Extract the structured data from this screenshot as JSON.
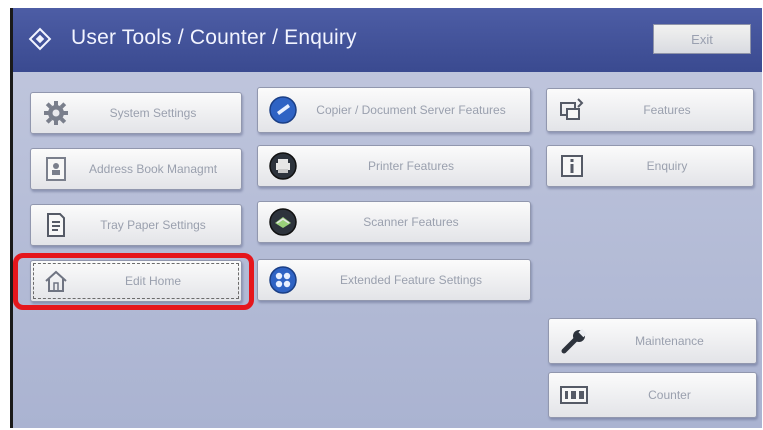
{
  "window": {
    "title": "User Tools / Counter / Enquiry",
    "exit_label": "Exit"
  },
  "left_column": [
    {
      "label": "System Settings",
      "icon": "gear-icon"
    },
    {
      "label": "Address Book Managmt",
      "icon": "address-book-icon"
    },
    {
      "label": "Tray Paper Settings",
      "icon": "tray-paper-icon"
    },
    {
      "label": "Edit Home",
      "icon": "home-icon",
      "highlighted": true
    }
  ],
  "middle_column": [
    {
      "label": "Copier / Document Server Features",
      "icon": "copier-icon"
    },
    {
      "label": "Printer Features",
      "icon": "printer-icon"
    },
    {
      "label": "Scanner Features",
      "icon": "scanner-icon"
    },
    {
      "label": "Extended Feature Settings",
      "icon": "extended-feature-icon"
    }
  ],
  "right_column": [
    {
      "label": "Features",
      "icon": "features-icon"
    },
    {
      "label": "Enquiry",
      "icon": "info-icon"
    },
    {
      "label": "Maintenance",
      "icon": "wrench-icon"
    },
    {
      "label": "Counter",
      "icon": "counter-icon"
    }
  ],
  "colors": {
    "title_bar": "#3a4a90",
    "panel_background": "#b7bfd9",
    "button_face": "#f4f4f4",
    "highlight_outline": "#e5161c",
    "feature_icon_blue": "#2f63c4"
  }
}
